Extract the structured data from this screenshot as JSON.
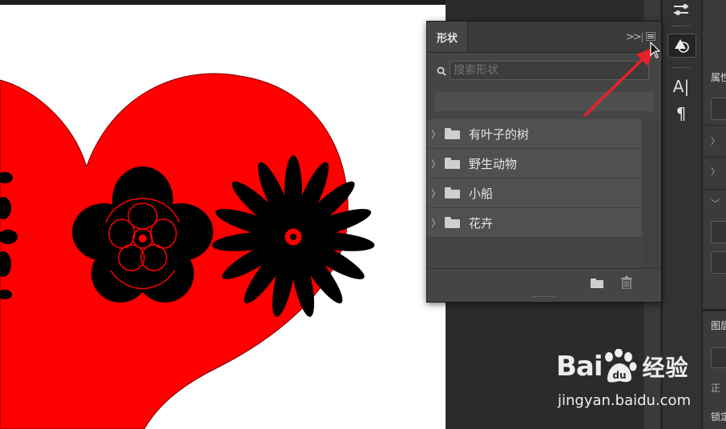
{
  "shapes_panel": {
    "tab_label": "形状",
    "search": {
      "placeholder": "搜索形状",
      "value": ""
    },
    "groups": [
      {
        "label": "有叶子的树"
      },
      {
        "label": "野生动物"
      },
      {
        "label": "小船"
      },
      {
        "label": "花卉"
      }
    ],
    "footer": {
      "new_group_icon": "folder-icon",
      "delete_icon": "trash-icon"
    },
    "menu_icon": "panel-menu-icon",
    "collapse_icon": "double-chevron-right-icon"
  },
  "toolstrip": {
    "items": [
      {
        "icon": "adjust-sliders-icon"
      },
      {
        "icon": "shapes-icon"
      },
      {
        "icon": "character-icon",
        "glyph": "A|"
      },
      {
        "icon": "paragraph-icon",
        "glyph": "¶"
      }
    ]
  },
  "right_column": {
    "properties_title": "属性",
    "layers_title": "图层",
    "mode_text": "正",
    "lock_text": "锁定"
  },
  "canvas": {
    "heart_color": "#ff0000",
    "flower_color": "#000000"
  },
  "annotation": {
    "arrow_color": "#e8212a"
  },
  "watermark": {
    "brand": "Bai",
    "brand_suffix": "经验",
    "url": "jingyan.baidu.com"
  },
  "colors": {
    "panel_bg": "#454545",
    "row_bg": "#505050",
    "workspace_bg": "#282828"
  }
}
